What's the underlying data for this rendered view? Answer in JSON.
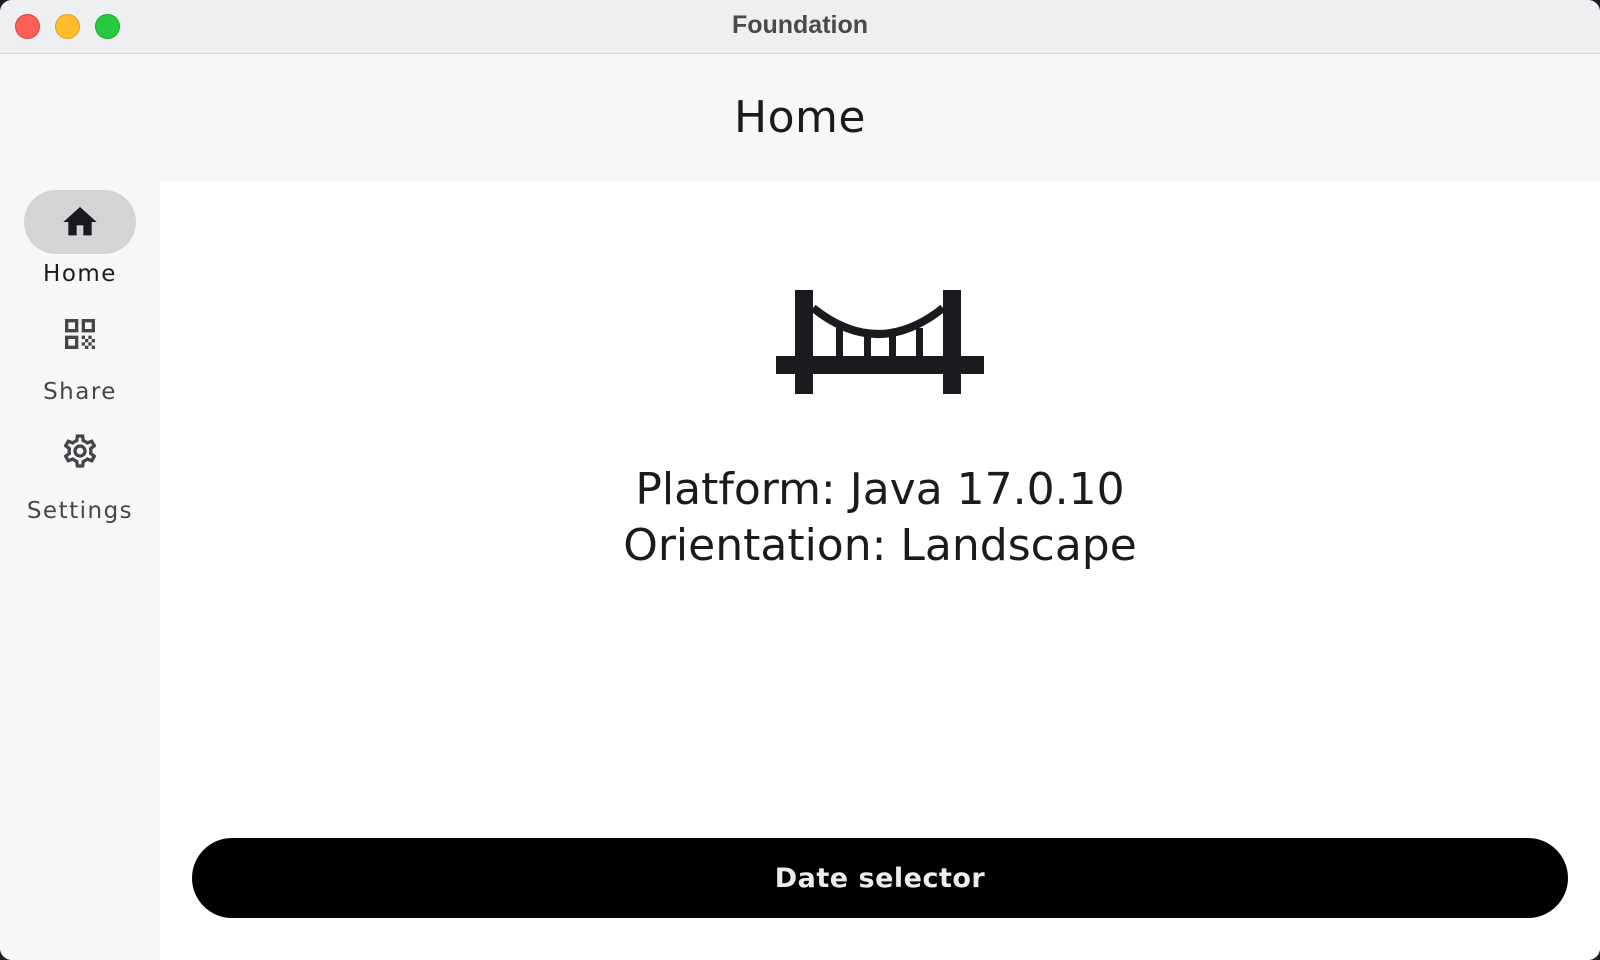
{
  "window": {
    "title": "Foundation",
    "controls": [
      "close",
      "minimize",
      "maximize"
    ]
  },
  "header": {
    "title": "Home"
  },
  "rail": {
    "items": [
      {
        "label": "Home",
        "icon": "home-icon",
        "selected": true
      },
      {
        "label": "Share",
        "icon": "qr-code-icon",
        "selected": false
      },
      {
        "label": "Settings",
        "icon": "gear-icon",
        "selected": false
      }
    ]
  },
  "main": {
    "hero_icon": "bridge-icon",
    "platform_text": "Platform: Java 17.0.10",
    "orientation_text": "Orientation: Landscape",
    "date_button_label": "Date selector"
  },
  "colors": {
    "selected_indicator": "#d4d4d6",
    "button_background": "#000000",
    "button_text": "#ececec"
  }
}
